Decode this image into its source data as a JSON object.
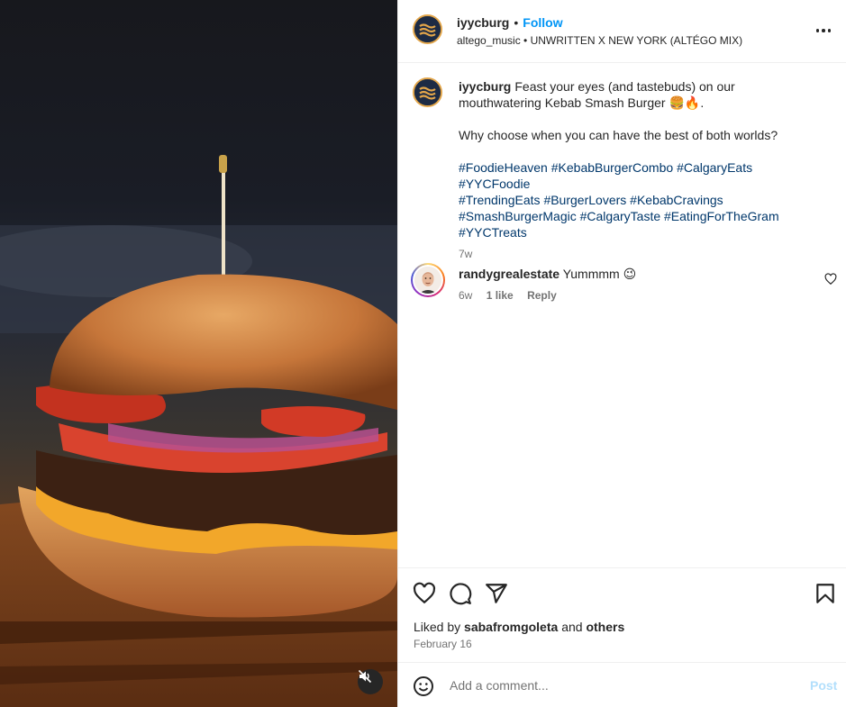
{
  "colors": {
    "accent": "#0095f6",
    "hashtag": "#00376b",
    "muted": "#737373",
    "post_disabled": "#b2dffc"
  },
  "post": {
    "username": "iyycburg",
    "separator": "•",
    "follow_label": "Follow",
    "audio": "altego_music • UNWRITTEN X NEW YORK (ALTÉGO MIX)"
  },
  "caption": {
    "username": "iyycburg",
    "line1": "Feast your eyes (and tastebuds) on our mouthwatering Kebab Smash Burger 🍔🔥.",
    "line2": "Why choose when you can have the best of both worlds?",
    "hashtags": [
      "#FoodieHeaven",
      "#KebabBurgerCombo",
      "#CalgaryEats",
      "#YYCFoodie",
      "#TrendingEats",
      "#BurgerLovers",
      "#KebabCravings",
      "#SmashBurgerMagic",
      "#CalgaryTaste",
      "#EatingForTheGram",
      "#YYCTreats"
    ],
    "time": "7w"
  },
  "comments": [
    {
      "username": "randygrealestate",
      "text": "Yummmm 😉",
      "time": "6w",
      "likes": "1 like",
      "reply_label": "Reply"
    }
  ],
  "likes": {
    "prefix": "Liked by",
    "user": "sabafromgoleta",
    "middle": "and",
    "others": "others"
  },
  "date": "February 16",
  "add_comment": {
    "placeholder": "Add a comment...",
    "post_label": "Post"
  },
  "icons": [
    "more-icon",
    "heart-icon",
    "comment-icon",
    "share-icon",
    "bookmark-icon",
    "emoji-icon",
    "mute-icon"
  ]
}
